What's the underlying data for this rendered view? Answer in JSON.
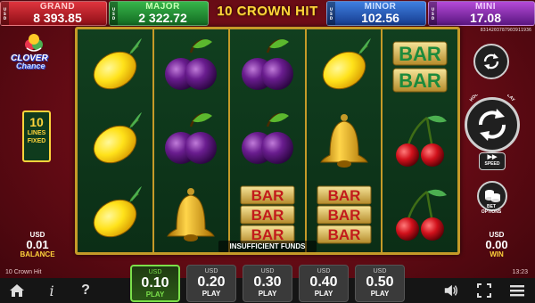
{
  "jackpots": {
    "currency_lines": [
      "U",
      "S",
      "D"
    ],
    "grand": {
      "name": "GRAND",
      "value": "8 393.85"
    },
    "major": {
      "name": "MAJOR",
      "value": "2 322.72"
    },
    "minor": {
      "name": "MINOR",
      "value": "102.56"
    },
    "mini": {
      "name": "MINI",
      "value": "17.08"
    }
  },
  "title": "10 CROWN HIT",
  "ticket_id": "8314203787903911936",
  "logo": {
    "line1": "CLOVER",
    "line2": "Chance"
  },
  "lines": {
    "count": "10",
    "label1": "LINES",
    "label2": "FIXED"
  },
  "balance": {
    "currency": "USD",
    "amount": "0.01",
    "label": "BALANCE"
  },
  "win": {
    "currency": "USD",
    "amount": "0.00",
    "label": "WIN"
  },
  "game_name": "10 Crown Hit",
  "clock": "13:23",
  "status_message": "INSUFFICIENT FUNDS",
  "spin_hint": "HOLD FOR FAST PLAY",
  "speed_label": "SPEED",
  "bet_options_label": {
    "line1": "BET",
    "line2": "OPTIONS"
  },
  "reels": [
    [
      "lemon",
      "lemon",
      "lemon"
    ],
    [
      "plum",
      "plum",
      "bell"
    ],
    [
      "plum",
      "plum",
      "bar-triple"
    ],
    [
      "lemon",
      "bell",
      "bar-triple"
    ],
    [
      "bar-double",
      "cherry",
      "cherry"
    ]
  ],
  "bets": [
    {
      "currency": "USD",
      "value": "0.10",
      "label": "PLAY",
      "selected": true
    },
    {
      "currency": "USD",
      "value": "0.20",
      "label": "PLAY",
      "selected": false
    },
    {
      "currency": "USD",
      "value": "0.30",
      "label": "PLAY",
      "selected": false
    },
    {
      "currency": "USD",
      "value": "0.40",
      "label": "PLAY",
      "selected": false
    },
    {
      "currency": "USD",
      "value": "0.50",
      "label": "PLAY",
      "selected": false
    }
  ],
  "bottom_icons": [
    "home-icon",
    "info-icon",
    "help-icon",
    "sound-icon",
    "fullscreen-icon",
    "menu-icon"
  ],
  "colors": {
    "accent": "#ffd43b",
    "selected_bet": "#7be04a",
    "reel_bg": "#113f1f",
    "frame": "#c59a28"
  }
}
